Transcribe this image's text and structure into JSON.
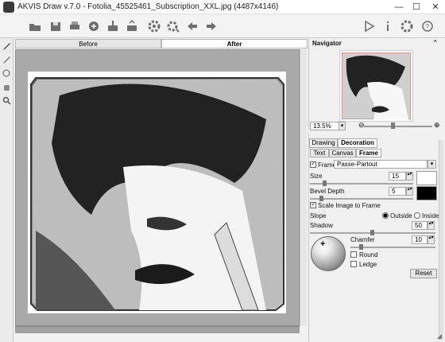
{
  "window": {
    "title": "AKVIS Draw v.7.0 - Fotolia_45525461_Subscription_XXL.jpg (4487x4146)",
    "minimize": "—",
    "maximize": "☐",
    "close": "✕"
  },
  "toolbar": {
    "icons": [
      "open-icon",
      "save-icon",
      "print-icon",
      "share-icon",
      "batch-icon",
      "import-icon",
      "settings-icon",
      "preset-icon",
      "undo-icon",
      "redo-icon",
      "run-icon",
      "info-icon",
      "preferences-icon",
      "help-icon"
    ]
  },
  "view_tabs": {
    "before": "Before",
    "after": "After"
  },
  "navigator": {
    "title": "Navigator",
    "zoom": "13.5%",
    "zoom_out": "⊖",
    "zoom_in": "⊕"
  },
  "panel_tabs": {
    "drawing": "Drawing",
    "decoration": "Decoration"
  },
  "sub_tabs": {
    "text": "Text",
    "canvas": "Canvas",
    "frame": "Frame"
  },
  "frame": {
    "frame_label": "Frame",
    "frame_type": "Passe-Partout",
    "size_label": "Size",
    "size_value": "15",
    "bevel_label": "Bevel Depth",
    "bevel_value": "5",
    "scale_label": "Scale Image to Frame",
    "slope_label": "Slope",
    "slope_outside": "Outside",
    "slope_inside": "Inside",
    "shadow_label": "Shadow",
    "shadow_value": "50",
    "chamfer_label": "Chamfer",
    "chamfer_value": "10",
    "round_label": "Round",
    "ledge_label": "Ledge",
    "reset_label": "Reset",
    "color_light": "#ffffff",
    "color_dark": "#000000"
  }
}
